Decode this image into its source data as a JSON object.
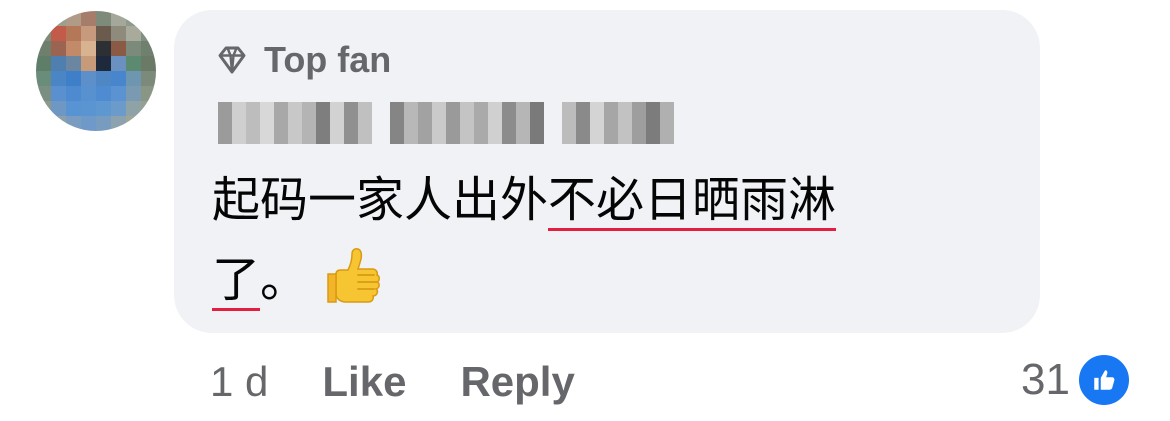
{
  "comment": {
    "badge_label": "Top fan",
    "text_line1_plain": "起码一家人出外",
    "text_line1_underlined": "不必日晒雨淋",
    "text_line2_underlined": "了",
    "text_line2_plain": "。",
    "emoji": "thumbs-up-emoji",
    "timestamp": "1 d",
    "like_label": "Like",
    "reply_label": "Reply",
    "reaction_count": "31",
    "reaction_icon": "like-reaction-icon",
    "colors": {
      "bubble": "#f0f2f5",
      "meta_text": "#65676b",
      "body_text": "#050505",
      "underline": "#e41e3f",
      "like_blue": "#1877f2"
    }
  }
}
